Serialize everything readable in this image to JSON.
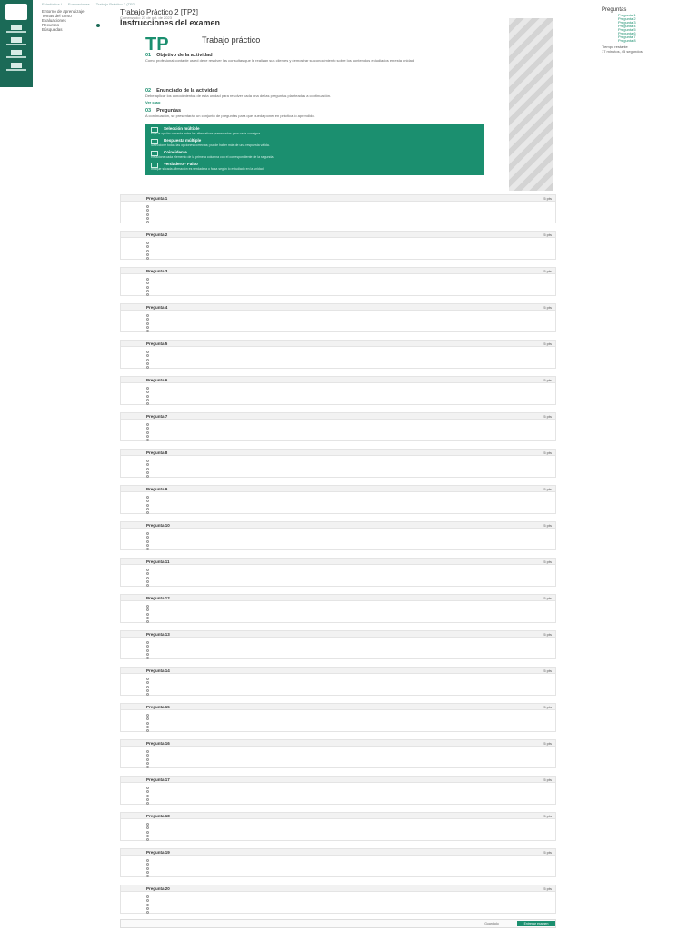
{
  "breadcrumb": [
    "Estadística I",
    "Evaluaciones",
    "Trabajo Práctico 2 (TP2)"
  ],
  "leftnav": [
    "Entorno de aprendizaje",
    "Temas del curso",
    "Evaluaciones",
    "Recursos",
    "Búsquedas"
  ],
  "course_title": "Trabajo Práctico 2 [TP2]",
  "course_sub": "Comenzado: 23 de oct. de 2023",
  "exam_title": "Instrucciones del examen",
  "hero": {
    "tp": "TP",
    "label": "Trabajo práctico"
  },
  "sections": [
    {
      "n": "01",
      "title": "Objetivo de la actividad"
    },
    {
      "n": "02",
      "title": "Enunciado de la actividad"
    },
    {
      "n": "03",
      "title": "Preguntas"
    }
  ],
  "para1": "Como profesional contable usted debe resolver las consultas que le realizan sus clientes y demostrar su conocimiento sobre los contenidos estudiados en esta unidad.",
  "para2": "Debe aplicar los conocimientos de esta unidad para resolver cada una de las preguntas planteadas a continuación.",
  "link": "Ver caso",
  "para3": "A continuación, se presentarán un conjunto de preguntas para que pueda poner en práctica lo aprendido.",
  "types": [
    {
      "t": "Selección múltiple",
      "d": "Elija la opción correcta entre las alternativas presentadas para cada consigna."
    },
    {
      "t": "Respuesta múltiple",
      "d": "Seleccione todas las opciones correctas; puede haber más de una respuesta válida."
    },
    {
      "t": "Coincidente",
      "d": "Relacione cada elemento de la primera columna con el correspondiente de la segunda."
    },
    {
      "t": "Verdadero - Falso",
      "d": "Indique si cada afirmación es verdadera o falsa según lo estudiado en la unidad."
    }
  ],
  "right": {
    "title": "Preguntas",
    "items": [
      "Pregunta 1",
      "Pregunta 2",
      "Pregunta 3",
      "Pregunta 4",
      "Pregunta 5",
      "Pregunta 6",
      "Pregunta 7",
      "Pregunta 8"
    ],
    "timer_label": "Tiempo restante",
    "timer_value": "17 minutos, 45 segundos"
  },
  "questions": [
    {
      "title": "Pregunta 1",
      "pts": "5 pts"
    },
    {
      "title": "Pregunta 2",
      "pts": "5 pts"
    },
    {
      "title": "Pregunta 3",
      "pts": "5 pts"
    },
    {
      "title": "Pregunta 4",
      "pts": "5 pts"
    },
    {
      "title": "Pregunta 5",
      "pts": "5 pts"
    },
    {
      "title": "Pregunta 6",
      "pts": "5 pts"
    },
    {
      "title": "Pregunta 7",
      "pts": "5 pts"
    },
    {
      "title": "Pregunta 8",
      "pts": "5 pts"
    },
    {
      "title": "Pregunta 9",
      "pts": "5 pts"
    },
    {
      "title": "Pregunta 10",
      "pts": "5 pts"
    },
    {
      "title": "Pregunta 11",
      "pts": "5 pts"
    },
    {
      "title": "Pregunta 12",
      "pts": "5 pts"
    },
    {
      "title": "Pregunta 13",
      "pts": "5 pts"
    },
    {
      "title": "Pregunta 14",
      "pts": "5 pts"
    },
    {
      "title": "Pregunta 15",
      "pts": "5 pts"
    },
    {
      "title": "Pregunta 16",
      "pts": "5 pts"
    },
    {
      "title": "Pregunta 17",
      "pts": "5 pts"
    },
    {
      "title": "Pregunta 18",
      "pts": "5 pts"
    },
    {
      "title": "Pregunta 19",
      "pts": "5 pts"
    },
    {
      "title": "Pregunta 20",
      "pts": "5 pts"
    }
  ],
  "bottom": {
    "save": "Guardado",
    "submit": "Entregar examen"
  }
}
